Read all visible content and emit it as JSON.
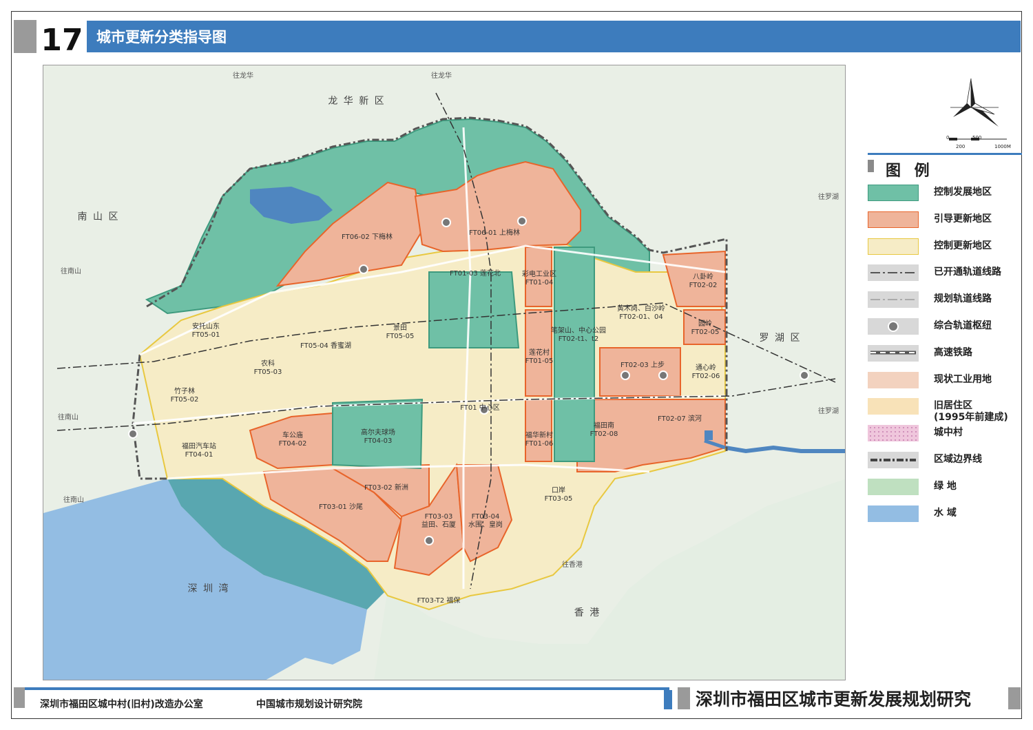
{
  "header": {
    "number": "17",
    "title": "城市更新分类指导图"
  },
  "footer": {
    "org": "深圳市福田区城中村(旧村)改造办公室",
    "institute": "中国城市规划设计研究院",
    "project": "深圳市福田区城市更新发展规划研究"
  },
  "scale": {
    "ticks": [
      "0",
      "500",
      "200",
      "1000M"
    ]
  },
  "legend": {
    "title": "图 例",
    "items": [
      {
        "label": "控制发展地区",
        "fill": "#6fc0a6",
        "border": "#3e9a7e",
        "pattern": "solid"
      },
      {
        "label": "引导更新地区",
        "fill": "#efb49a",
        "border": "#e8642a",
        "pattern": "solid"
      },
      {
        "label": "控制更新地区",
        "fill": "#f6ecc6",
        "border": "#e8c840",
        "pattern": "solid"
      },
      {
        "label": "已开通轨道线路",
        "fill": "#d8d8d8",
        "border": "#d8d8d8",
        "pattern": "rail-open"
      },
      {
        "label": "规划轨道线路",
        "fill": "#d8d8d8",
        "border": "#d8d8d8",
        "pattern": "rail-plan"
      },
      {
        "label": "综合轨道枢纽",
        "fill": "#d8d8d8",
        "border": "#d8d8d8",
        "pattern": "hub"
      },
      {
        "label": "高速铁路",
        "fill": "#d8d8d8",
        "border": "#d8d8d8",
        "pattern": "hsr"
      },
      {
        "label": "现状工业用地",
        "fill": "#f3d2bf",
        "border": "#f3d2bf",
        "pattern": "solid"
      },
      {
        "label": "旧居住区\n(1995年前建成)",
        "fill": "#f8e2b8",
        "border": "#f8e2b8",
        "pattern": "solid"
      },
      {
        "label": "城中村",
        "fill": "#efc6dc",
        "border": "#efc6dc",
        "pattern": "dots"
      },
      {
        "label": "区域边界线",
        "fill": "#d8d8d8",
        "border": "#d8d8d8",
        "pattern": "boundary"
      },
      {
        "label": "绿 地",
        "fill": "#bfe0c0",
        "border": "#bfe0c0",
        "pattern": "solid"
      },
      {
        "label": "水 域",
        "fill": "#93bde3",
        "border": "#93bde3",
        "pattern": "solid"
      }
    ]
  },
  "map": {
    "districts": [
      {
        "name": "龙 华 新 区"
      },
      {
        "name": "南 山 区"
      },
      {
        "name": "罗 湖 区"
      },
      {
        "name": "深 圳 湾"
      },
      {
        "name": "香 港"
      }
    ],
    "roads": [
      "往龙华",
      "往龙华",
      "往南山",
      "往南山",
      "往南山",
      "往罗湖",
      "往罗湖",
      "往香港"
    ],
    "zones": [
      "FT06-02 下梅林",
      "FT06-01 上梅林",
      "FT01-03 莲花北",
      "彩电工业区\nFT01-04",
      "八卦岭\nFT02-02",
      "黄木岗、白沙岭\nFT02-01、04",
      "安托山东\nFT05-01",
      "FT05-04 香蜜湖",
      "景田\nFT05-05",
      "笔架山、中心公园\nFT02-t1、t2",
      "园岭\nFT02-05",
      "农科\nFT05-03",
      "莲花村\nFT01-05",
      "FT02-03 上步",
      "通心岭\nFT02-06",
      "竹子林\nFT05-02",
      "FT01 中心区",
      "FT02-07 滨河",
      "福田南\nFT02-08",
      "车公庙\nFT04-02",
      "福田汽车站\nFT04-01",
      "高尔夫球场\nFT04-03",
      "福华新村\nFT01-06",
      "口岸\nFT03-05",
      "FT03-02 新洲",
      "FT03-01 沙尾",
      "FT03-03\n益田、石厦",
      "FT03-04\n水围、皇岗",
      "FT03-T2 福保"
    ]
  }
}
